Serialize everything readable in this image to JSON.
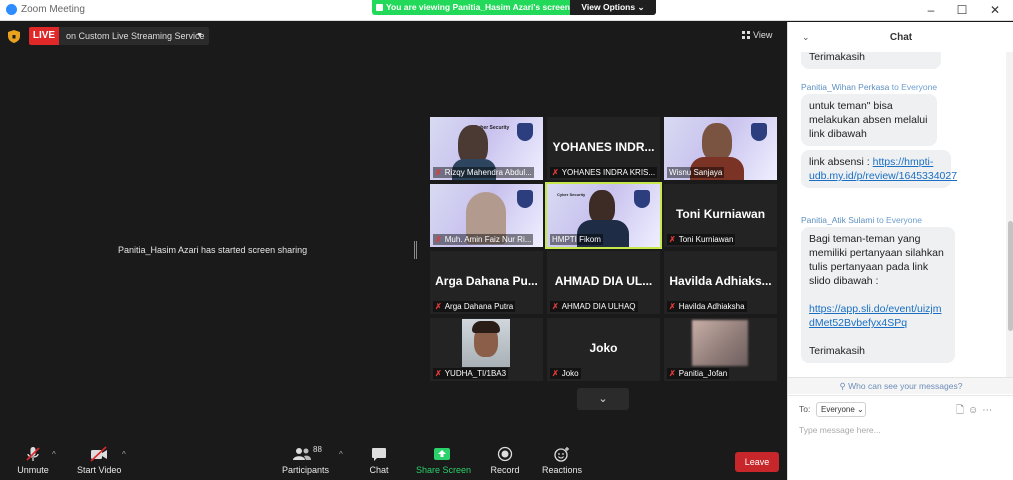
{
  "window": {
    "title": "Zoom Meeting",
    "controls": [
      "–",
      "☐",
      "✕"
    ]
  },
  "banner": {
    "text": "You are viewing Panitia_Hasim Azari's screen",
    "view_options": "View Options ⌄"
  },
  "stage": {
    "live_label": "LIVE",
    "live_service": "on Custom Live Streaming Service",
    "view_label": "View",
    "share_message": "Panitia_Hasim Azari has started screen sharing"
  },
  "gallery": {
    "tiles": [
      {
        "name": "Rizqy Mahendra Abdul...",
        "big": "",
        "muted": true
      },
      {
        "name": "YOHANES INDRA KRIS...",
        "big": "YOHANES INDR...",
        "muted": true
      },
      {
        "name": "Wisnu Sanjaya",
        "big": "",
        "muted": false
      },
      {
        "name": "Muh. Amin Faiz Nur Ri...",
        "big": "",
        "muted": true
      },
      {
        "name": "HMPTI Fikom",
        "big": "",
        "muted": false
      },
      {
        "name": "Toni Kurniawan",
        "big": "Toni Kurniawan",
        "muted": true
      },
      {
        "name": "Arga Dahana Putra",
        "big": "Arga Dahana Pu...",
        "muted": true
      },
      {
        "name": "AHMAD DIA ULHAQ",
        "big": "AHMAD DIA UL...",
        "muted": true
      },
      {
        "name": "Havilda Adhiaksha",
        "big": "Havilda Adhiaks...",
        "muted": true
      },
      {
        "name": "YUDHA_TI/1BA3",
        "big": "",
        "muted": true
      },
      {
        "name": "Joko",
        "big": "Joko",
        "muted": true
      },
      {
        "name": "Panitia_Jofan",
        "big": "",
        "muted": true
      }
    ],
    "slide_text": "Cyber Security"
  },
  "toolbar": {
    "unmute": "Unmute",
    "start_video": "Start Video",
    "participants": "Participants",
    "participants_count": "88",
    "chat": "Chat",
    "share_screen": "Share Screen",
    "record": "Record",
    "reactions": "Reactions",
    "leave": "Leave"
  },
  "chat": {
    "title": "Chat",
    "messages": {
      "m0": "Terimakasih",
      "s1_name": "Panitia_Wihan Perkasa",
      "s1_to": "to Everyone",
      "m1": "untuk teman\" bisa melakukan absen melalui link dibawah",
      "m2_text": "link absensi : ",
      "m2_link": "https://hmpti-udb.my.id/p/review/1645334027",
      "s2_name": "Panitia_Atik Sulami",
      "s2_to": "to Everyone",
      "m3_text": "Bagi teman-teman yang memiliki pertanyaan silahkan tulis pertanyaan pada link slido dibawah :",
      "m3_link": "https://app.sli.do/event/uizjmdMet52Bvbefyx4SPq",
      "m3_end": "Terimakasih"
    },
    "who_can_see": "Who can see your messages?",
    "to_label": "To:",
    "to_value": "Everyone ⌄",
    "input_placeholder": "Type message here..."
  },
  "colors": {
    "accent_green": "#23d959",
    "live_red": "#e02828",
    "leave_red": "#c7262a",
    "link_blue": "#1a6fc4",
    "active_tile_border": "#c7e84a"
  }
}
